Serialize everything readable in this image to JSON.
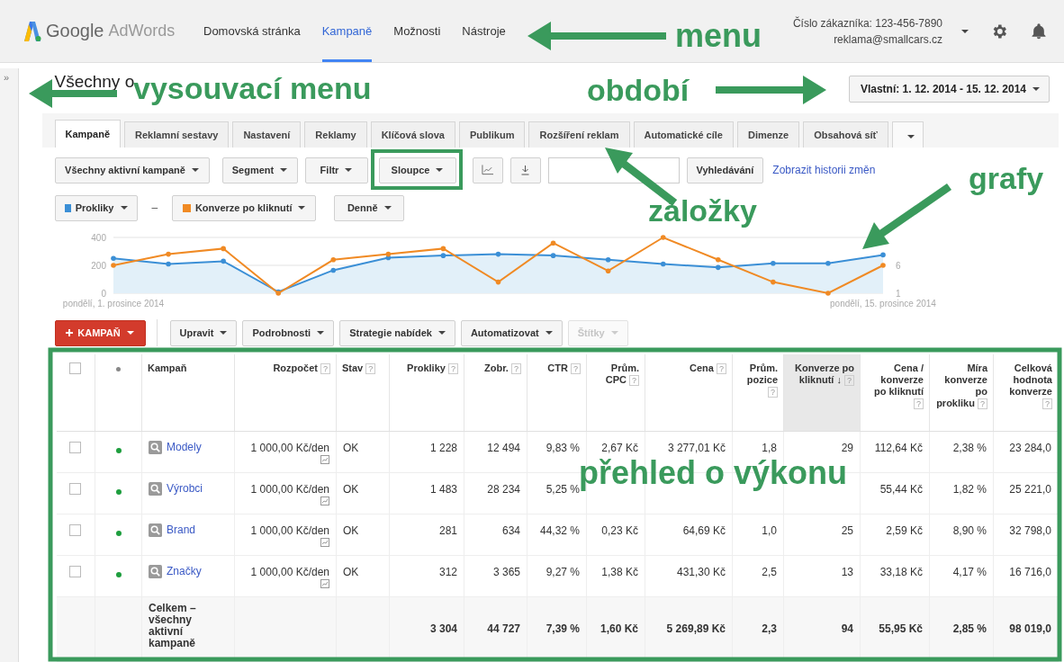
{
  "header": {
    "brand": "Google",
    "product": "AdWords",
    "nav": [
      {
        "label": "Domovská stránka",
        "selected": false
      },
      {
        "label": "Kampaně",
        "selected": true
      },
      {
        "label": "Možnosti",
        "selected": false
      },
      {
        "label": "Nástroje",
        "selected": false
      }
    ],
    "customer": "Číslo zákazníka: 123-456-7890",
    "email": "reklama@smallcars.cz"
  },
  "sidebar": {
    "toggle": "»"
  },
  "title": "Všechny o",
  "date_range": "Vlastní: 1. 12. 2014 - 15. 12. 2014",
  "tabs": [
    {
      "label": "Kampaně",
      "selected": true
    },
    {
      "label": "Reklamní sestavy",
      "selected": false
    },
    {
      "label": "Nastavení",
      "selected": false
    },
    {
      "label": "Reklamy",
      "selected": false
    },
    {
      "label": "Klíčová slova",
      "selected": false
    },
    {
      "label": "Publikum",
      "selected": false
    },
    {
      "label": "Rozšíření reklam",
      "selected": false
    },
    {
      "label": "Automatické cíle",
      "selected": false
    },
    {
      "label": "Dimenze",
      "selected": false
    },
    {
      "label": "Obsahová síť",
      "selected": false
    }
  ],
  "toolbar": {
    "filter": "Všechny aktivní kampaně",
    "segment": "Segment",
    "filtr": "Filtr",
    "columns": "Sloupce",
    "search_button": "Vyhledávání",
    "history_link": "Zobrazit historii změn"
  },
  "chart_controls": {
    "separator": "–",
    "interval": "Denně"
  },
  "chart": {
    "chart_data": {
      "type": "line",
      "categories": [
        "pondělí, 1. prosince 2014",
        null,
        null,
        null,
        null,
        null,
        null,
        null,
        null,
        null,
        null,
        null,
        null,
        null,
        "pondělí, 15. prosince 2014"
      ],
      "ylim": [
        0,
        400
      ],
      "yticks": [
        0,
        200,
        400
      ],
      "y2lim": [
        1,
        11
      ],
      "y2ticks": [
        1,
        6
      ],
      "series": [
        {
          "name": "Prokliky",
          "color": "#3b8fd6",
          "type": "area",
          "values": [
            250,
            210,
            230,
            10,
            165,
            255,
            270,
            280,
            270,
            240,
            210,
            185,
            215,
            215,
            275
          ]
        },
        {
          "name": "Konverze po kliknutí",
          "color": "#f08a24",
          "axis": "y2",
          "values": [
            6,
            8,
            9,
            1,
            7,
            8,
            9,
            3,
            10,
            5,
            11,
            7,
            3,
            1,
            6
          ]
        }
      ]
    }
  },
  "actions": [
    {
      "label": "KAMPAŇ",
      "kind": "primary"
    },
    {
      "label": "Upravit",
      "kind": "menu",
      "disabled": false
    },
    {
      "label": "Podrobnosti",
      "kind": "menu",
      "disabled": false
    },
    {
      "label": "Strategie nabídek",
      "kind": "menu",
      "disabled": false
    },
    {
      "label": "Automatizovat",
      "kind": "menu",
      "disabled": false
    },
    {
      "label": "Štítky",
      "kind": "menu",
      "disabled": true
    }
  ],
  "table": {
    "header_checked": false,
    "columns": [
      {
        "label": "Kampaň",
        "sorted": false
      },
      {
        "label": "Rozpočet",
        "hint": "?",
        "sorted": false
      },
      {
        "label": "Stav",
        "hint": "?",
        "sorted": false
      },
      {
        "label": "Prokliky",
        "hint": "?",
        "sorted": false
      },
      {
        "label": "Zobr.",
        "hint": "?",
        "sorted": false
      },
      {
        "label": "CTR",
        "hint": "?",
        "sorted": false
      },
      {
        "label": "Prům. CPC",
        "hint": "?",
        "sorted": false
      },
      {
        "label": "Cena",
        "hint": "?",
        "sorted": false
      },
      {
        "label": "Prům. pozice",
        "hint": "?",
        "sorted": false
      },
      {
        "label": "Konverze po kliknutí",
        "hint": "?",
        "sort_mark": "↓",
        "sorted": true
      },
      {
        "label": "Cena / konverze po kliknutí",
        "hint": "?",
        "sorted": false
      },
      {
        "label": "Míra konverze po prokliku",
        "hint": "?",
        "sorted": false
      },
      {
        "label": "Celková hodnota konverze",
        "hint": "?",
        "sorted": false
      }
    ],
    "rows": [
      {
        "checked": false,
        "color": "#1e9e3e",
        "cells": [
          "Modely",
          "1 000,00 Kč/den",
          "OK",
          "1 228",
          "12 494",
          "9,83 %",
          "2,67 Kč",
          "3 277,01 Kč",
          "1,8",
          "29",
          "112,64 Kč",
          "2,38 %",
          "23 284,0"
        ]
      },
      {
        "checked": false,
        "color": "#1e9e3e",
        "cells": [
          "Výrobci",
          "1 000,00 Kč/den",
          "OK",
          "1 483",
          "28 234",
          "5,25 %",
          null,
          null,
          null,
          null,
          "55,44 Kč",
          "1,82 %",
          "25 221,0"
        ]
      },
      {
        "checked": false,
        "color": "#1e9e3e",
        "cells": [
          "Brand",
          "1 000,00 Kč/den",
          "OK",
          "281",
          "634",
          "44,32 %",
          "0,23 Kč",
          "64,69 Kč",
          "1,0",
          "25",
          "2,59 Kč",
          "8,90 %",
          "32 798,0"
        ]
      },
      {
        "checked": false,
        "color": "#1e9e3e",
        "cells": [
          "Značky",
          "1 000,00 Kč/den",
          "OK",
          "312",
          "3 365",
          "9,27 %",
          "1,38 Kč",
          "431,30 Kč",
          "2,5",
          "13",
          "33,18 Kč",
          "4,17 %",
          "16 716,0"
        ]
      }
    ],
    "total": {
      "cells": [
        "Celkem – všechny aktivní kampaně",
        null,
        null,
        "3 304",
        "44 727",
        "7,39 %",
        "1,60 Kč",
        "5 269,89 Kč",
        "2,3",
        "94",
        "55,95 Kč",
        "2,85 %",
        "98 019,0"
      ]
    }
  },
  "annotations": [
    {
      "text": "menu"
    },
    {
      "text": "vysouvací menu"
    },
    {
      "text": "období"
    },
    {
      "text": "grafy"
    },
    {
      "text": "záložky"
    },
    {
      "text": "přehled o výkonu"
    }
  ]
}
